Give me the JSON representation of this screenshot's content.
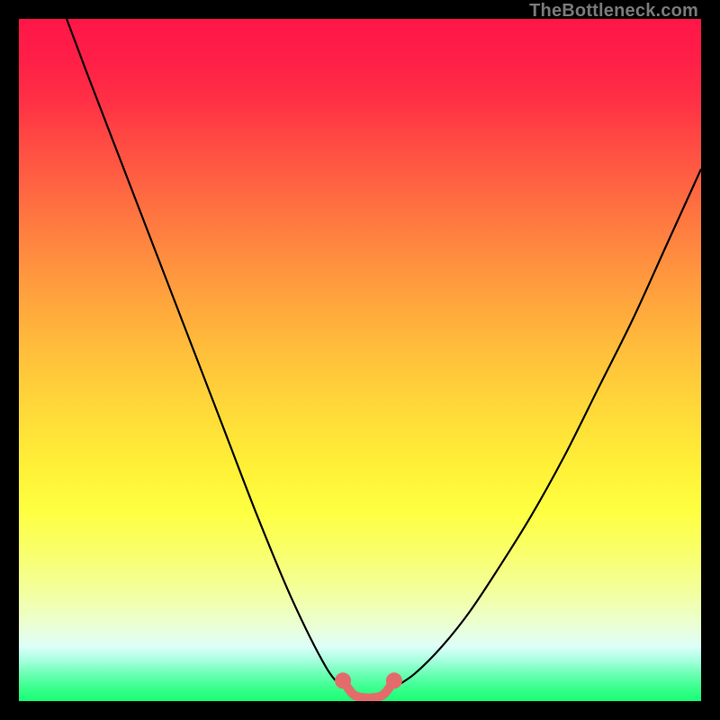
{
  "watermark": "TheBottleneck.com",
  "colors": {
    "frame": "#000000",
    "gradient_top": "#ff1648",
    "gradient_mid": "#ffe138",
    "gradient_bottom": "#18ff74",
    "curve": "#000000",
    "marker": "#e46b6b"
  },
  "chart_data": {
    "type": "line",
    "title": "",
    "xlabel": "",
    "ylabel": "",
    "xlim": [
      0,
      100
    ],
    "ylim": [
      0,
      100
    ],
    "series": [
      {
        "name": "left-curve",
        "x": [
          7,
          10,
          15,
          20,
          25,
          30,
          35,
          40,
          45,
          47.5
        ],
        "y": [
          100,
          92,
          79,
          66,
          53,
          40,
          27,
          15,
          5,
          2
        ]
      },
      {
        "name": "right-curve",
        "x": [
          55,
          58,
          62,
          66,
          70,
          75,
          80,
          85,
          90,
          95,
          100
        ],
        "y": [
          2,
          4,
          8,
          13,
          19,
          27,
          36,
          46,
          56,
          67,
          78
        ]
      },
      {
        "name": "marker-segment",
        "x": [
          47.5,
          49,
          50.5,
          52,
          53.5,
          55
        ],
        "y": [
          3,
          1,
          0.5,
          0.5,
          1,
          3
        ]
      }
    ],
    "markers": {
      "endpoints": [
        {
          "x": 47.5,
          "y": 3
        },
        {
          "x": 55,
          "y": 3
        }
      ]
    }
  }
}
